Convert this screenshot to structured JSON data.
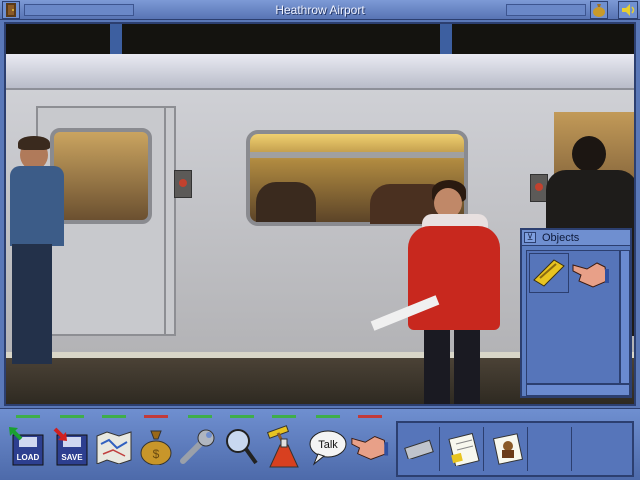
{
  "window": {
    "title": "Heathrow Airport",
    "icons": [
      "door-icon",
      "money-bag-icon",
      "speaker-icon"
    ]
  },
  "objects_panel": {
    "title": "Objects",
    "collapse_glyph": "⊻",
    "items": [
      {
        "icon": "gold-card-icon"
      },
      {
        "icon": "hand-icon"
      }
    ]
  },
  "toolbar": {
    "tools": [
      {
        "label": "LOAD",
        "icon": "load-disk-icon",
        "indicator": "#3fae4a"
      },
      {
        "label": "SAVE",
        "icon": "save-disk-icon",
        "indicator": "#3fae4a"
      },
      {
        "icon": "map-icon",
        "indicator": "#3fae4a"
      },
      {
        "icon": "money-bag-icon",
        "indicator": "#c23a3a"
      },
      {
        "icon": "wrench-icon",
        "indicator": "#3fae4a"
      },
      {
        "icon": "magnifier-icon",
        "indicator": "#3fae4a"
      },
      {
        "icon": "hammer-flask-icon",
        "indicator": "#3fae4a"
      },
      {
        "label": "Talk",
        "icon": "speech-bubble-icon",
        "indicator": "#3fae4a"
      },
      {
        "icon": "hand-icon",
        "indicator": "#c23a3a"
      }
    ],
    "inventory": [
      {
        "icon": "ticket-icon"
      },
      {
        "icon": "notepad-icon"
      },
      {
        "icon": "photo-icon"
      }
    ]
  }
}
